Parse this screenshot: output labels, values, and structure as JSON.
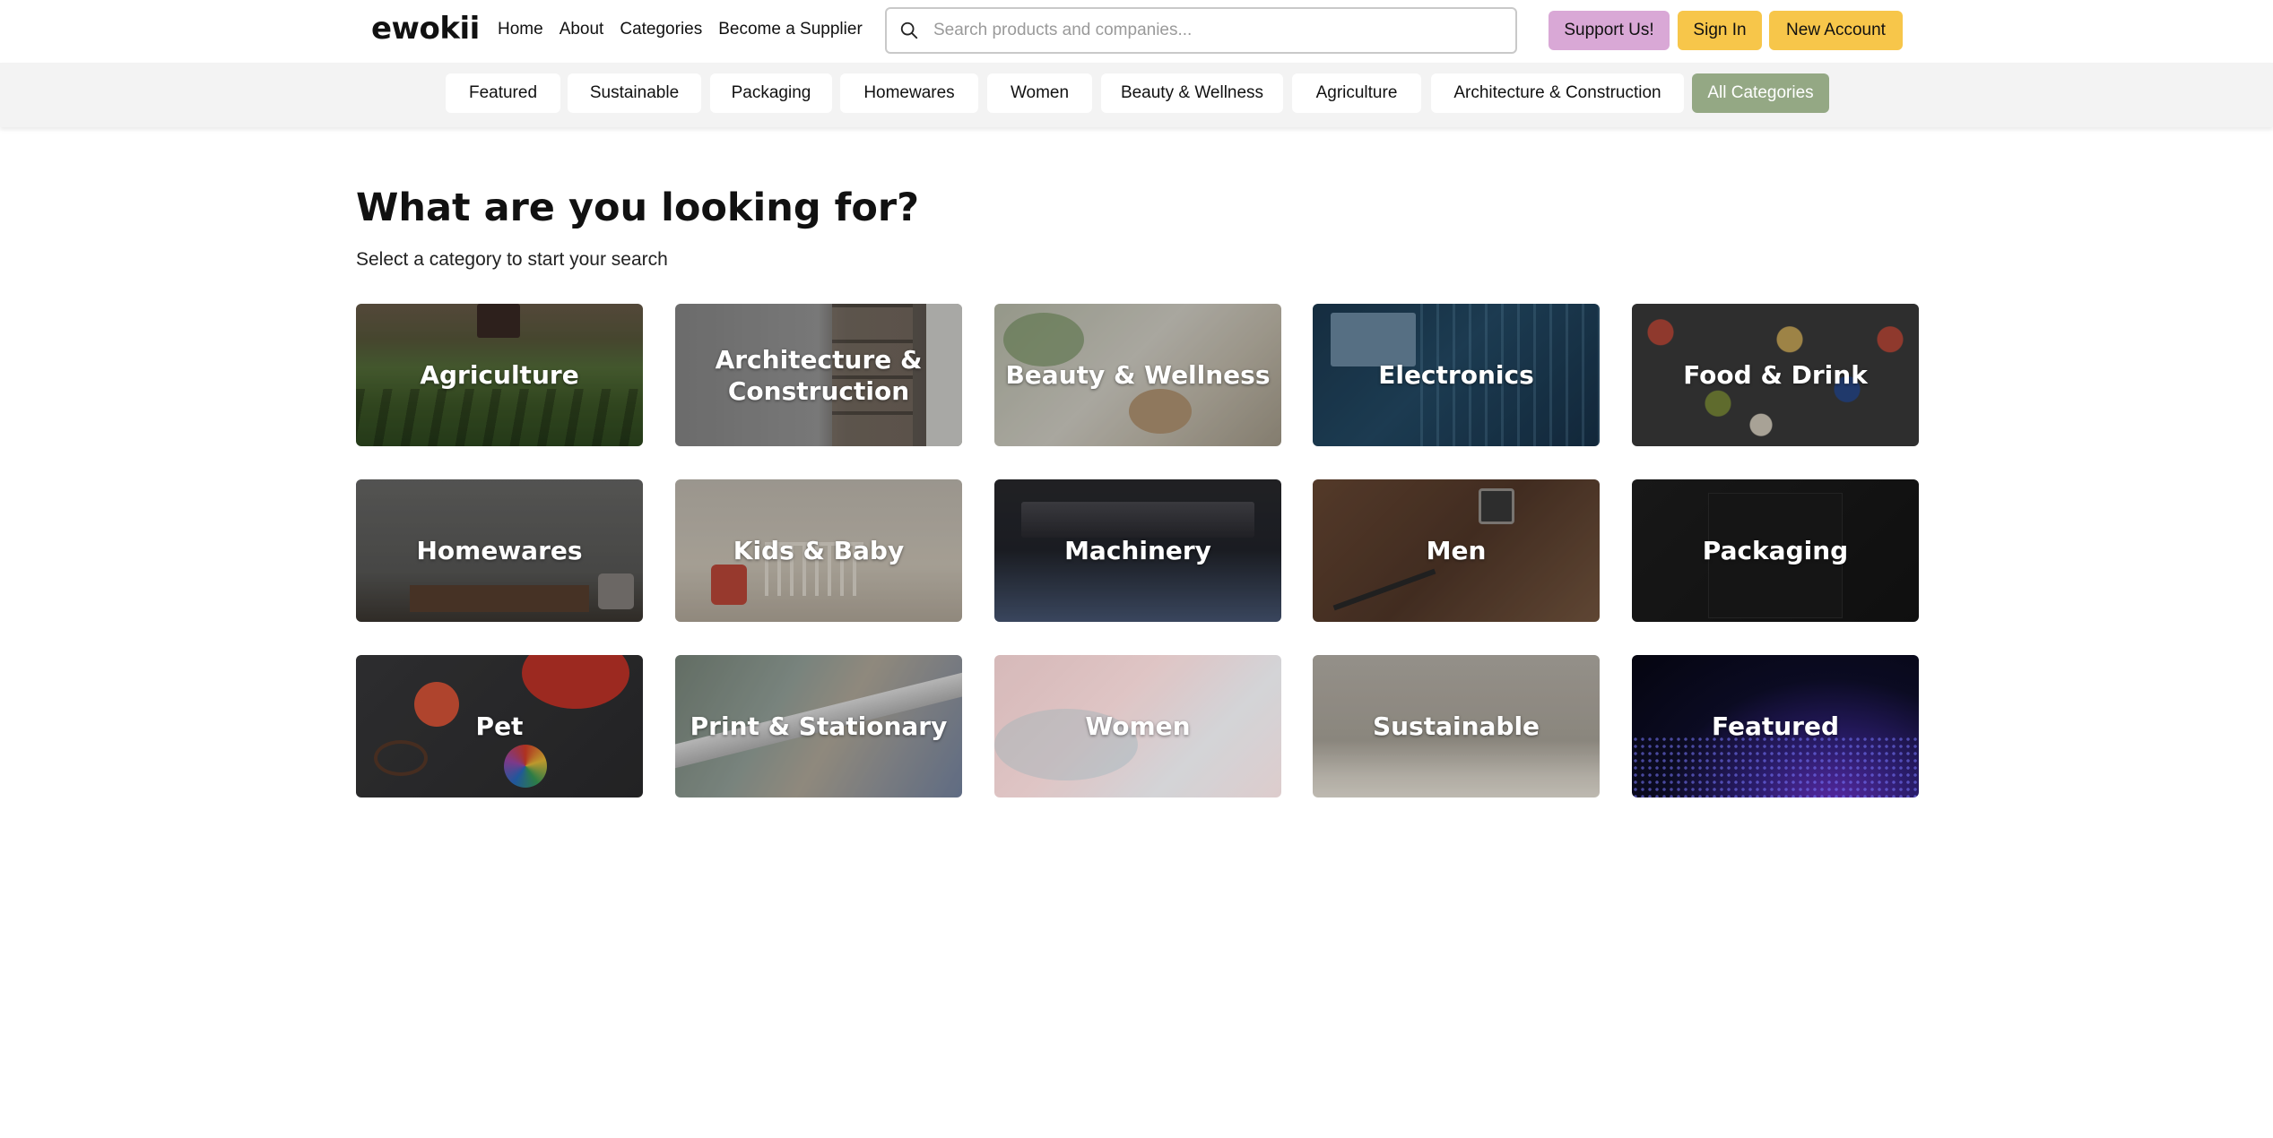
{
  "header": {
    "logo": "ewokii",
    "nav": [
      "Home",
      "About",
      "Categories",
      "Become a Supplier"
    ],
    "search_placeholder": "Search products and companies...",
    "buttons": {
      "support": "Support Us!",
      "signin": "Sign In",
      "new_account": "New Account"
    }
  },
  "category_bar": {
    "items": [
      "Featured",
      "Sustainable",
      "Packaging",
      "Homewares",
      "Women",
      "Beauty & Wellness",
      "Agriculture",
      "Architecture & Construction",
      "All Categories"
    ],
    "active": "All Categories"
  },
  "main": {
    "title": "What are you looking for?",
    "subtitle": "Select a category to start your search",
    "tiles": [
      "Agriculture",
      "Architecture & Construction",
      "Beauty & Wellness",
      "Electronics",
      "Food & Drink",
      "Homewares",
      "Kids & Baby",
      "Machinery",
      "Men",
      "Packaging",
      "Pet",
      "Print & Stationary",
      "Women",
      "Sustainable",
      "Featured"
    ]
  },
  "colors": {
    "accent_yellow": "#f7c64a",
    "support_purple": "#d9a8d6",
    "active_chip": "#94a884"
  }
}
